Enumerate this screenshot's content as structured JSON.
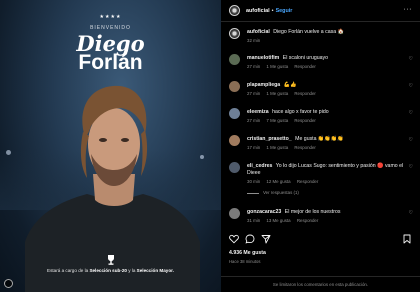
{
  "post_image": {
    "stars": "★★★★",
    "welcome": "BIENVENIDO",
    "first_name": "Diego",
    "last_name": "Forlán",
    "caption_text_1": "Estará a cargo de la ",
    "caption_bold_1": "Selección sub-20",
    "caption_text_2": " y la ",
    "caption_bold_2": "Selección Mayor."
  },
  "header": {
    "username": "aufoficial",
    "dot": "•",
    "follow_label": "Seguir",
    "more": "···"
  },
  "caption": {
    "username": "aufoficial",
    "text": "Diego Forlán vuelve a casa 🏠",
    "time": "32 min"
  },
  "comments": [
    {
      "username": "manuelotifim",
      "text": "El scaloni uruguayo",
      "time": "27 min",
      "likes": "1 Me gusta",
      "reply": "Responder"
    },
    {
      "username": "plapampliega",
      "text": "💪👍",
      "time": "27 min",
      "likes": "1 Me gusta",
      "reply": "Responder"
    },
    {
      "username": "eleemiza",
      "text": "hace algo x favor te pido",
      "time": "27 min",
      "likes": "7 Me gusta",
      "reply": "Responder"
    },
    {
      "username": "cristian_prasetto_",
      "text": "Me gusta 👏👏👏👏",
      "time": "17 min",
      "likes": "1 Me gusta",
      "reply": "Responder"
    },
    {
      "username": "eli_cedres",
      "text": "Yo lo dijo Lucas Sugo: sentimiento y pasión 🔴 vamo el Dieee",
      "time": "30 min",
      "likes": "12 Me gusta",
      "reply": "Responder",
      "view_replies": "Ver respuestas (1)"
    },
    {
      "username": "gonzacarac23",
      "text": "El mejor de los nuestros",
      "time": "31 min",
      "likes": "13 Me gusta",
      "reply": "Responder"
    }
  ],
  "stats": {
    "likes": "4.936 Me gusta",
    "time_ago": "Hace 38 minutos"
  },
  "footer": {
    "notice": "Se limitaron los comentarios en esta publicación."
  },
  "colors": {
    "follow": "#4aa8ff",
    "background": "#000000",
    "muted": "#8e8e8e"
  }
}
